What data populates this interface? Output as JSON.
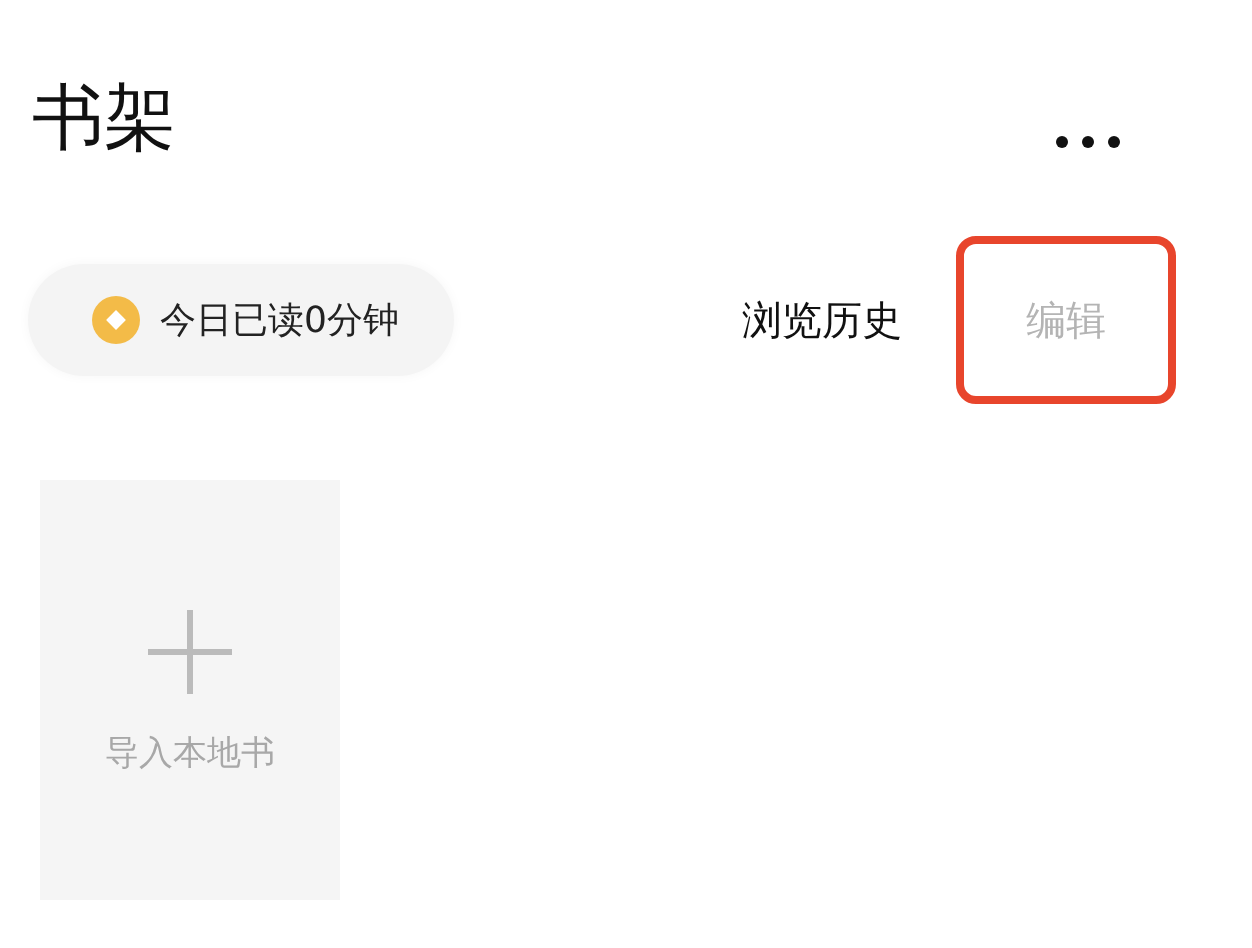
{
  "header": {
    "title": "书架"
  },
  "reading_badge": {
    "text": "今日已读0分钟"
  },
  "actions": [
    {
      "label": "浏览历史",
      "kind": "link",
      "disabled": false,
      "highlighted": false
    },
    {
      "label": "编辑",
      "kind": "button",
      "disabled": true,
      "highlighted": true
    }
  ],
  "shelf": {
    "import_card": {
      "label": "导入本地书"
    }
  }
}
